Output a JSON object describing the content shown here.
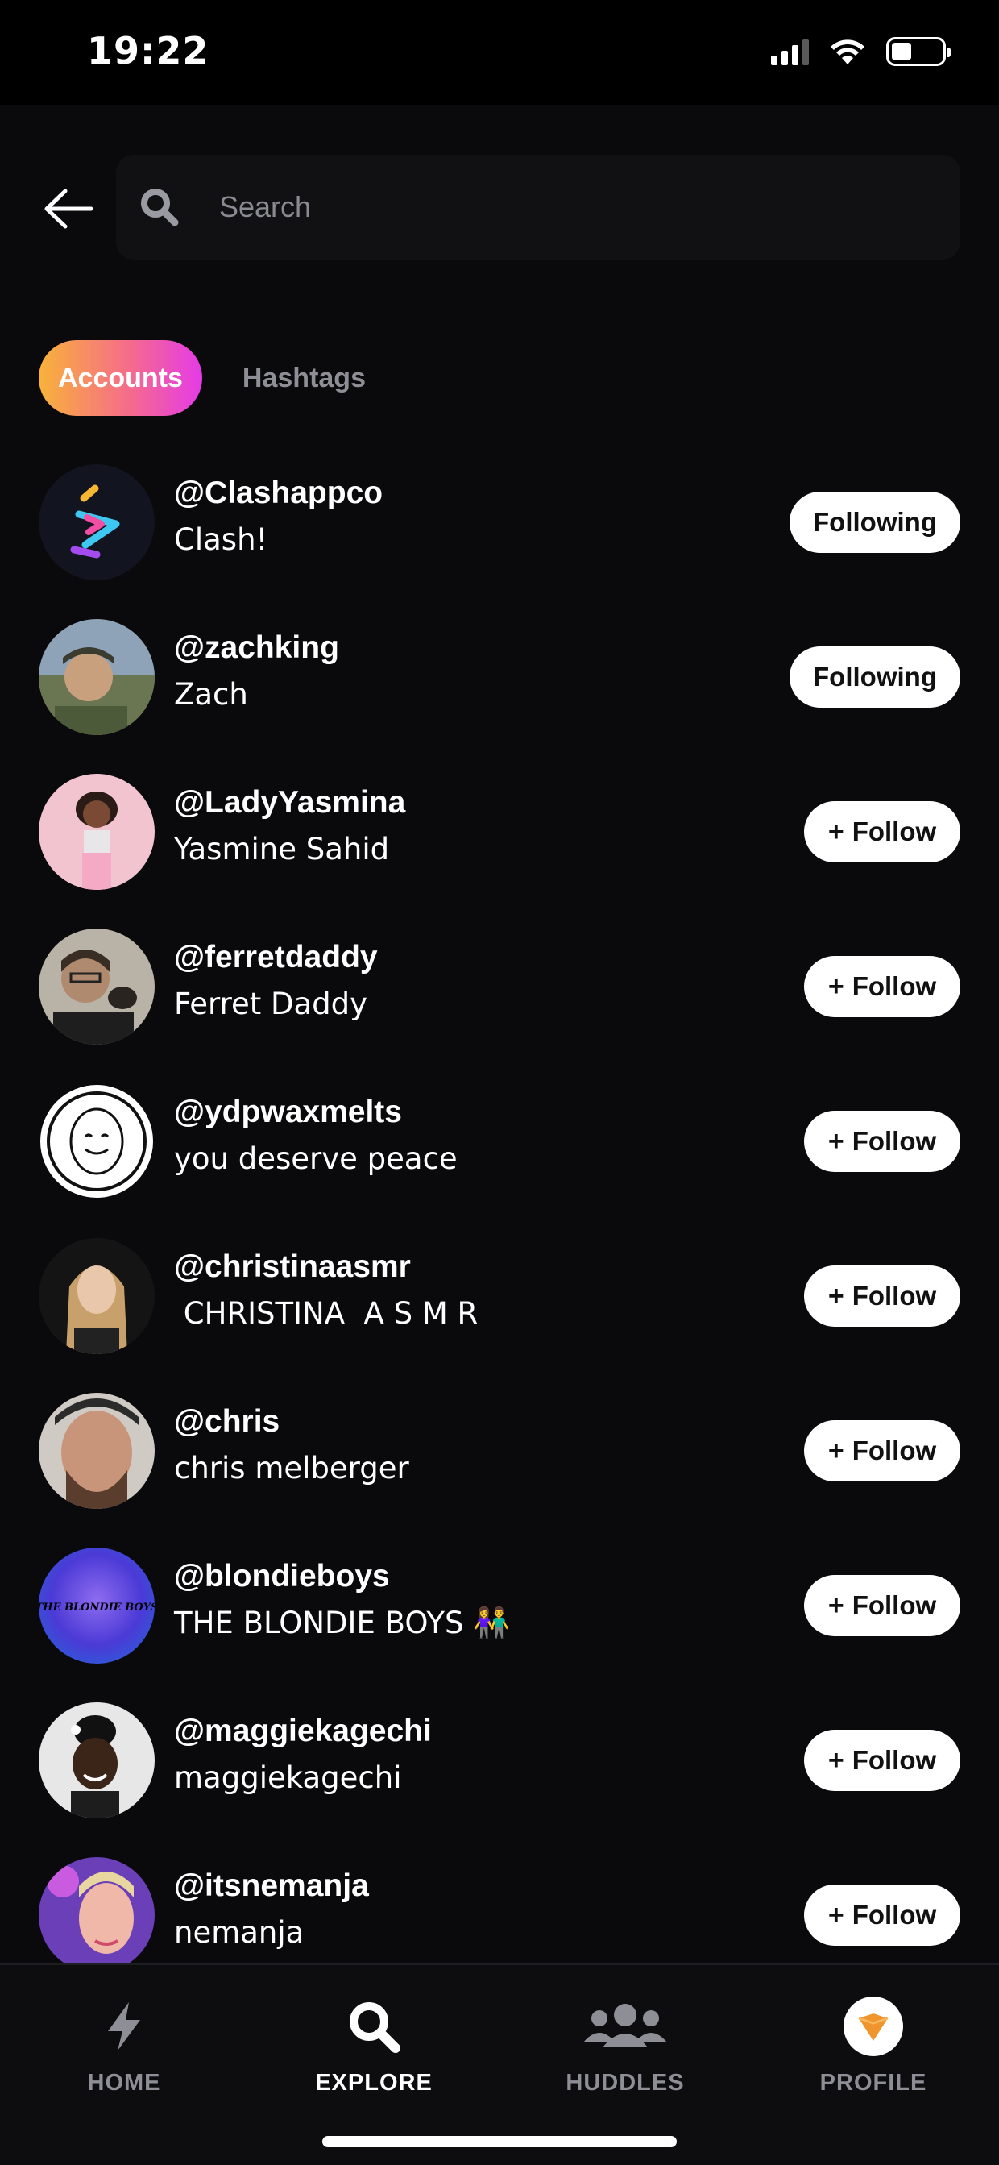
{
  "status_bar": {
    "time": "19:22"
  },
  "search": {
    "placeholder": "Search",
    "value": ""
  },
  "tabs": {
    "accounts": "Accounts",
    "hashtags": "Hashtags",
    "active": "Accounts"
  },
  "colors": {
    "tab_gradient": [
      "#f9b23a",
      "#f56c8a",
      "#e53ae8"
    ],
    "background": "#0a0a0d"
  },
  "accounts": [
    {
      "username": "@Clashappco",
      "name": "Clash!",
      "button": "Following",
      "following": true
    },
    {
      "username": "@zachking",
      "name": "Zach",
      "button": "Following",
      "following": true
    },
    {
      "username": "@LadyYasmina",
      "name": "Yasmine Sahid",
      "button": "Follow",
      "following": false
    },
    {
      "username": "@ferretdaddy",
      "name": "Ferret Daddy",
      "button": "Follow",
      "following": false
    },
    {
      "username": "@ydpwaxmelts",
      "name": "you deserve peace",
      "button": "Follow",
      "following": false
    },
    {
      "username": "@christinaasmr",
      "name": " CHRISTINA  A S M R",
      "button": "Follow",
      "following": false
    },
    {
      "username": "@chris",
      "name": "chris melberger",
      "button": "Follow",
      "following": false
    },
    {
      "username": "@blondieboys",
      "name": "THE BLONDIE BOYS 👫",
      "button": "Follow",
      "following": false,
      "avatar_text": "THE BLONDIE BOYS"
    },
    {
      "username": "@maggiekagechi",
      "name": "maggiekagechi",
      "button": "Follow",
      "following": false
    },
    {
      "username": "@itsnemanja",
      "name": "nemanja",
      "button": "Follow",
      "following": false
    }
  ],
  "bottom_nav": [
    {
      "label": "HOME",
      "icon": "lightning-icon",
      "active": false
    },
    {
      "label": "EXPLORE",
      "icon": "search-icon",
      "active": true
    },
    {
      "label": "HUDDLES",
      "icon": "group-icon",
      "active": false
    },
    {
      "label": "PROFILE",
      "icon": "profile-avatar-icon",
      "active": false
    }
  ]
}
